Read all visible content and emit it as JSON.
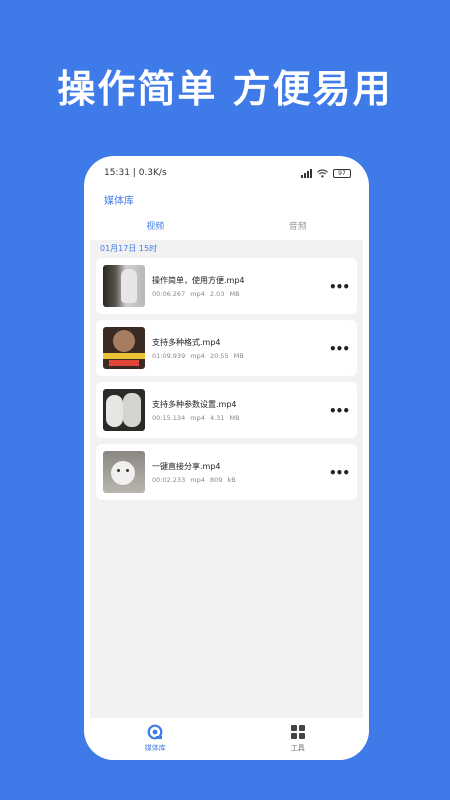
{
  "headline": "操作简单 方便易用",
  "status_bar": {
    "time_speed": "15:31 | 0.3K/s",
    "battery": "97"
  },
  "app": {
    "title": "媒体库"
  },
  "tabs": [
    {
      "label": "视频"
    },
    {
      "label": "音频"
    }
  ],
  "date_header": "01月17日  15时",
  "media_items": [
    {
      "name": "操作简单，使用方便.mp4",
      "duration": "00:06.267",
      "format": "mp4",
      "size": "2.03 MB"
    },
    {
      "name": "支持多种格式.mp4",
      "duration": "01:09.939",
      "format": "mp4",
      "size": "20.55 MB"
    },
    {
      "name": "支持多种参数设置.mp4",
      "duration": "00:15.134",
      "format": "mp4",
      "size": "4.31 MB"
    },
    {
      "name": "一键直接分享.mp4",
      "duration": "00:02.233",
      "format": "mp4",
      "size": "809 kB"
    }
  ],
  "more_symbol": "•••",
  "bottom_nav": [
    {
      "label": "媒体库",
      "icon": "media-library-icon"
    },
    {
      "label": "工具",
      "icon": "tools-grid-icon"
    }
  ],
  "colors": {
    "background": "#3f7be8",
    "accent": "#3f7be8",
    "content_bg": "#f2f2f2"
  }
}
